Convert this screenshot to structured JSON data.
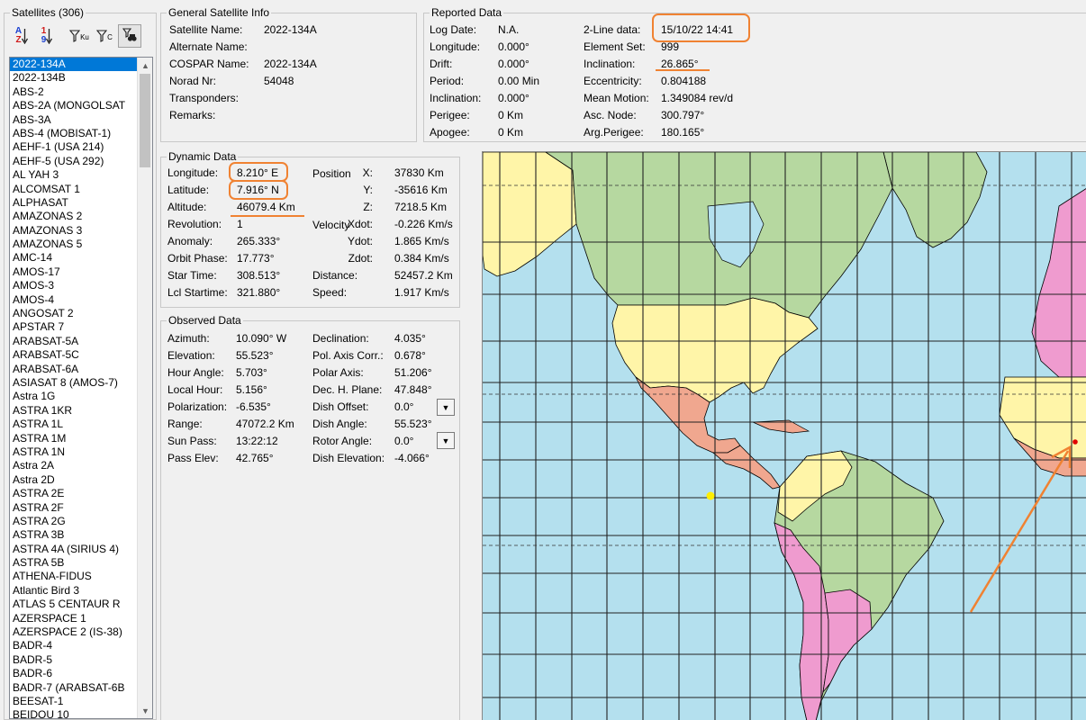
{
  "satellites": {
    "title": "Satellites (306)",
    "selected_index": 0,
    "items": [
      "2022-134A",
      "2022-134B",
      "ABS-2",
      "ABS-2A (MONGOLSAT",
      "ABS-3A",
      "ABS-4 (MOBISAT-1)",
      "AEHF-1 (USA 214)",
      "AEHF-5 (USA 292)",
      "AL YAH 3",
      "ALCOMSAT 1",
      "ALPHASAT",
      "AMAZONAS 2",
      "AMAZONAS 3",
      "AMAZONAS 5",
      "AMC-14",
      "AMOS-17",
      "AMOS-3",
      "AMOS-4",
      "ANGOSAT 2",
      "APSTAR 7",
      "ARABSAT-5A",
      "ARABSAT-5C",
      "ARABSAT-6A",
      "ASIASAT 8 (AMOS-7)",
      "Astra 1G",
      "ASTRA 1KR",
      "ASTRA 1L",
      "ASTRA 1M",
      "ASTRA 1N",
      "Astra 2A",
      "Astra 2D",
      "ASTRA 2E",
      "ASTRA 2F",
      "ASTRA 2G",
      "ASTRA 3B",
      "ASTRA 4A (SIRIUS 4)",
      "ASTRA 5B",
      "ATHENA-FIDUS",
      "Atlantic Bird 3",
      "ATLAS 5 CENTAUR R",
      "AZERSPACE 1",
      "AZERSPACE 2 (IS-38)",
      "BADR-4",
      "BADR-5",
      "BADR-6",
      "BADR-7 (ARABSAT-6B",
      "BEESAT-1",
      "BEIDOU 10"
    ]
  },
  "toolbar": {
    "sort_az_top": "A",
    "sort_az_bottom": "Z",
    "sort_num_top": "1",
    "sort_num_bottom": "9",
    "filter_ku": "Ku",
    "filter_c": "C"
  },
  "general": {
    "title": "General Satellite Info",
    "labels": [
      "Satellite Name:",
      "Alternate Name:",
      "COSPAR Name:",
      "Norad Nr:",
      "Transponders:",
      "Remarks:"
    ],
    "values": [
      "2022-134A",
      "",
      "2022-134A",
      "54048",
      "",
      ""
    ]
  },
  "reported": {
    "title": "Reported Data",
    "left_labels": [
      "Log Date:",
      "Longitude:",
      "Drift:",
      "Period:",
      "Inclination:",
      "Perigee:",
      "Apogee:"
    ],
    "left_values": [
      "N.A.",
      "0.000°",
      "0.000°",
      "0.00 Min",
      "0.000°",
      "0 Km",
      "0 Km"
    ],
    "right_labels": [
      "2-Line data:",
      "Element Set:",
      "Inclination:",
      "Eccentricity:",
      "Mean Motion:",
      "Asc. Node:",
      "Arg.Perigee:"
    ],
    "right_values": [
      "15/10/22 14:41",
      "999",
      "26.865°",
      "0.804188",
      "1.349084 rev/d",
      "300.797°",
      "180.165°"
    ]
  },
  "dynamic": {
    "title": "Dynamic Data",
    "left_labels": [
      "Longitude:",
      "Latitude:",
      "Altitude:",
      "Revolution:",
      "Anomaly:",
      "Orbit Phase:",
      "Star Time:",
      "Lcl Startime:"
    ],
    "left_values": [
      "8.210° E",
      "7.916° N",
      "46079.4 Km",
      "1",
      "265.333°",
      "17.773°",
      "308.513°",
      "321.880°"
    ],
    "pos_label": "Position",
    "vel_label": "Velocity",
    "right_labels": [
      "X:",
      "Y:",
      "Z:",
      "Xdot:",
      "Ydot:",
      "Zdot:",
      "Distance:",
      "Speed:"
    ],
    "right_values": [
      "37830 Km",
      "-35616 Km",
      "7218.5 Km",
      "-0.226 Km/s",
      "1.865 Km/s",
      "0.384 Km/s",
      "52457.2 Km",
      "1.917 Km/s"
    ]
  },
  "observed": {
    "title": "Observed Data",
    "left_labels": [
      "Azimuth:",
      "Elevation:",
      "Hour Angle:",
      "Local Hour:",
      "Polarization:",
      "Range:",
      "Sun Pass:",
      "Pass Elev:"
    ],
    "left_values": [
      "10.090° W",
      "55.523°",
      "5.703°",
      "5.156°",
      "-6.535°",
      "47072.2 Km",
      "13:22:12",
      "42.765°"
    ],
    "right_labels": [
      "Declination:",
      "Pol. Axis Corr.:",
      "Polar Axis:",
      "Dec. H. Plane:",
      "Dish Offset:",
      "Dish Angle:",
      "Rotor Angle:",
      "Dish Elevation:"
    ],
    "right_values": [
      "4.035°",
      "0.678°",
      "51.206°",
      "47.848°",
      "0.0°",
      "55.523°",
      "0.0°",
      "-4.066°"
    ]
  },
  "colors": {
    "ocean": "#b4e0ee",
    "land_green": "#b6d8a0",
    "land_yellow": "#fff5a8",
    "land_pink": "#ef9bcf",
    "land_salmon": "#f0a78f",
    "highlight": "#f08232",
    "selection": "#0078d7"
  }
}
